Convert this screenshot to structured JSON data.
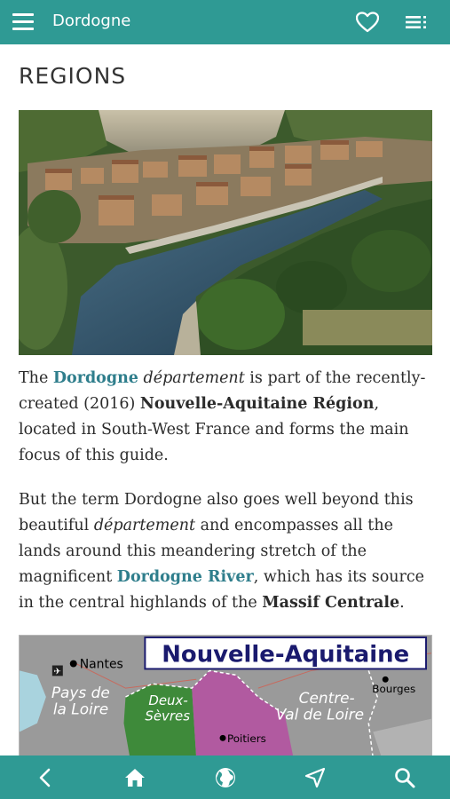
{
  "header": {
    "title": "Dordogne",
    "menu_icon": "hamburger-menu-icon",
    "favorite_icon": "heart-icon",
    "contents_icon": "list-icon"
  },
  "page": {
    "heading": "REGIONS"
  },
  "paragraph1": {
    "t1": "The ",
    "link1": "Dordogne",
    "t2": " ",
    "em1": "département",
    "t3": " is part of the recently-created (2016) ",
    "b1": "Nouvelle-Aquitaine Région",
    "t4": ", located in South-West France and forms the main focus of this guide."
  },
  "paragraph2": {
    "t1": "But the term Dordogne also goes well beyond this beautiful ",
    "em1": "département",
    "t2": " and encompasses all the lands around this meandering stretch of the magnificent ",
    "link1": "Dordogne River",
    "t3": ", which has its source in the central highlands of the ",
    "b1": "Massif Centrale",
    "t4": "."
  },
  "map": {
    "title": "Nouvelle-Aquitaine",
    "labels": {
      "nantes": "Nantes",
      "pays_de_la_loire_1": "Pays de",
      "pays_de_la_loire_2": "la Loire",
      "deux_sevres_1": "Deux-",
      "deux_sevres_2": "Sèvres",
      "poitiers": "Poitiers",
      "centre_1": "Centre-",
      "centre_2": "Val de Loire",
      "bourges": "Bourges"
    }
  },
  "bottom_nav": [
    {
      "name": "back-button",
      "icon": "chevron-left-icon"
    },
    {
      "name": "home-button",
      "icon": "home-icon"
    },
    {
      "name": "globe-button",
      "icon": "globe-icon"
    },
    {
      "name": "location-button",
      "icon": "navigation-arrow-icon"
    },
    {
      "name": "search-button",
      "icon": "search-icon"
    }
  ],
  "colors": {
    "bar": "#2f9a94",
    "link": "#2f7e8c"
  }
}
